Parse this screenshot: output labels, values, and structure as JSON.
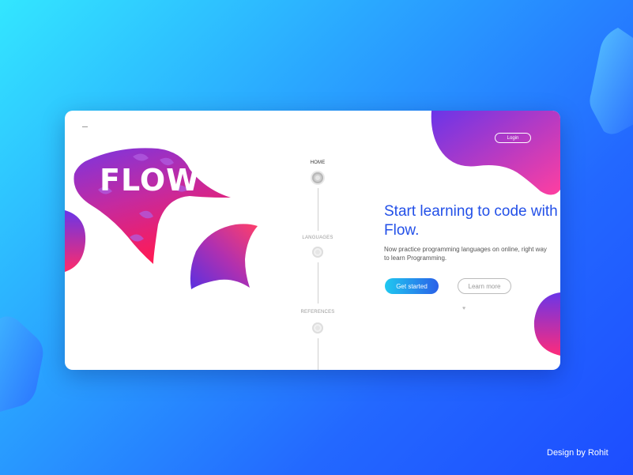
{
  "brand": {
    "name": "FLOW"
  },
  "header": {
    "login_label": "Login"
  },
  "nav": {
    "items": [
      {
        "label": "HOME",
        "active": true
      },
      {
        "label": "LANGUAGES",
        "active": false
      },
      {
        "label": "REFERENCES",
        "active": false
      }
    ]
  },
  "hero": {
    "headline": "Start learning to code with Flow.",
    "subtitle": "Now practice programming languages on online, right way to learn Programming.",
    "primary_cta": "Get started",
    "secondary_cta": "Learn more",
    "scroll_icon": "chevron-down-icon"
  },
  "footer": {
    "credit": "Design by Rohit"
  },
  "colors": {
    "accent_blue": "#2350e8",
    "gradient_pink": "#ff2b7a",
    "gradient_purple": "#6a35e8",
    "background_cyan": "#33e6ff",
    "background_blue": "#1d4dff"
  }
}
